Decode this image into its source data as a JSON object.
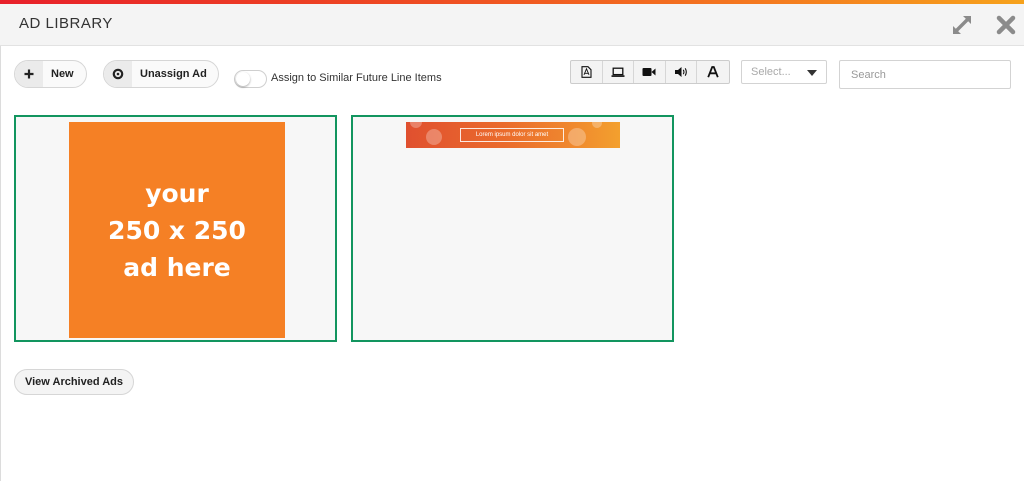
{
  "header": {
    "title": "AD LIBRARY",
    "expand_icon": "expand-icon",
    "close_icon": "close-icon",
    "accent_gradient": [
      "#e8202a",
      "#f47a1f",
      "#f6a21c"
    ]
  },
  "toolbar": {
    "new_label": "New",
    "unassign_label": "Unassign Ad",
    "toggle_label": "Assign to Similar Future Line Items",
    "toggle_on": false,
    "filter_icons": [
      "pdf-file-icon",
      "laptop-icon",
      "video-camera-icon",
      "speaker-icon",
      "text-font-icon"
    ],
    "select_placeholder": "Select...",
    "search_placeholder": "Search"
  },
  "ads": [
    {
      "kind": "display-250",
      "lines": [
        "your",
        "250 x 250",
        "ad here"
      ],
      "color": "#f58025"
    },
    {
      "kind": "banner",
      "caption": "Lorem ipsum dolor sit amet"
    }
  ],
  "card_border_color": "#12955f",
  "footer": {
    "archived_label": "View Archived Ads"
  }
}
